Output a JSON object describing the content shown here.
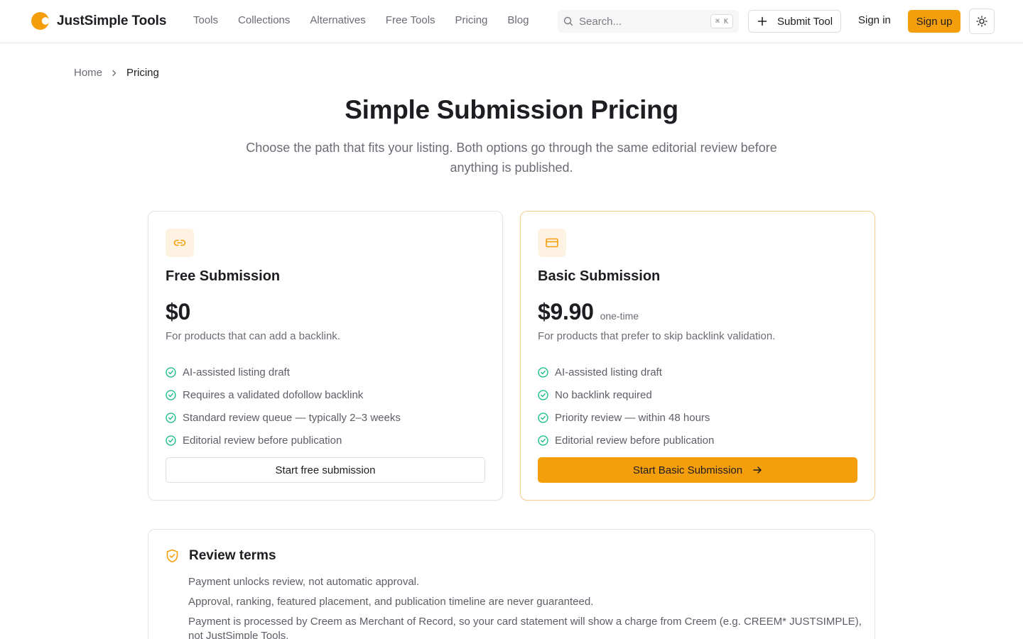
{
  "brand": {
    "name": "JustSimple Tools",
    "accent": "#f59e0b",
    "success": "#10b981"
  },
  "nav": {
    "items": [
      "Tools",
      "Collections",
      "Alternatives",
      "Free Tools",
      "Pricing",
      "Blog"
    ]
  },
  "search": {
    "placeholder": "Search...",
    "shortcut": "⌘ K"
  },
  "header": {
    "submit_tool": "Submit Tool",
    "sign_in": "Sign in",
    "sign_up": "Sign up",
    "theme_icon": "sun-icon"
  },
  "breadcrumb": {
    "home": "Home",
    "current": "Pricing"
  },
  "hero": {
    "title": "Simple Submission Pricing",
    "subtitle": "Choose the path that fits your listing. Both options go through the same editorial review before anything is published."
  },
  "plans": [
    {
      "icon": "link-icon",
      "title": "Free Submission",
      "price": "$0",
      "price_note": "",
      "description": "For products that can add a backlink.",
      "features": [
        "AI-assisted listing draft",
        "Requires a validated dofollow backlink",
        "Standard review queue — typically 2–3 weeks",
        "Editorial review before publication"
      ],
      "cta": "Start free submission"
    },
    {
      "icon": "credit-card-icon",
      "title": "Basic Submission",
      "price": "$9.90",
      "price_note": "one-time",
      "description": "For products that prefer to skip backlink validation.",
      "features": [
        "AI-assisted listing draft",
        "No backlink required",
        "Priority review — within 48 hours",
        "Editorial review before publication"
      ],
      "cta": "Start Basic Submission"
    }
  ],
  "terms": {
    "title": "Review terms",
    "items": [
      "Payment unlocks review, not automatic approval.",
      "Approval, ranking, featured placement, and publication timeline are never guaranteed.",
      "Payment is processed by Creem as Merchant of Record, so your card statement will show a charge from Creem (e.g. CREEM* JUSTSIMPLE), not JustSimple Tools."
    ]
  }
}
